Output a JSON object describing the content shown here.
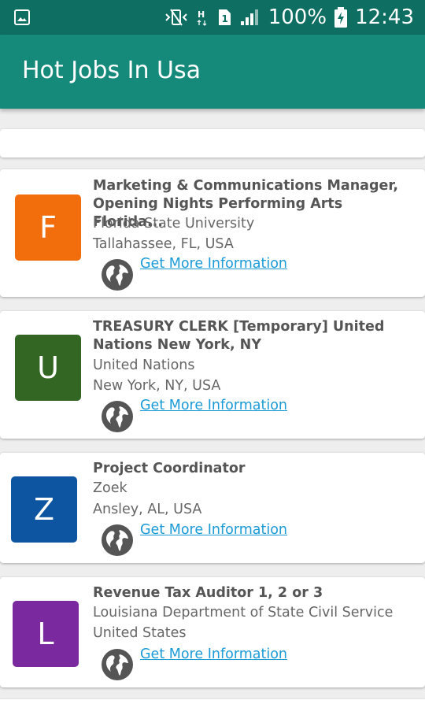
{
  "status_bar": {
    "battery": "100%",
    "time": "12:43",
    "icons": [
      "image-icon",
      "vibrate-icon",
      "h-signal-icon",
      "sim1-icon",
      "signal-bars-icon",
      "battery-charging-icon"
    ]
  },
  "app_bar": {
    "title": "Hot Jobs In Usa",
    "color": "#168a7a"
  },
  "jobs": [
    {
      "letter": "F",
      "avatar_color": "#f26d0c",
      "title": "Marketing & Communications Manager, Opening Nights Performing Arts Florida...",
      "company": "Florida State University",
      "location": "Tallahassee, FL, USA",
      "link_label": "Get More Information"
    },
    {
      "letter": "U",
      "avatar_color": "#336622",
      "title": "TREASURY CLERK [Temporary] United Nations New York, NY",
      "company": "United Nations",
      "location": "New York, NY, USA",
      "link_label": "Get More Information"
    },
    {
      "letter": "Z",
      "avatar_color": "#0d55a0",
      "title": "Project Coordinator",
      "company": "Zoek",
      "location": "Ansley, AL, USA",
      "link_label": "Get More Information"
    },
    {
      "letter": "L",
      "avatar_color": "#7a2a9e",
      "title": "Revenue Tax Auditor 1, 2 or 3",
      "company": "Louisiana Department of State Civil Service",
      "location": "United States",
      "link_label": "Get More Information"
    }
  ]
}
